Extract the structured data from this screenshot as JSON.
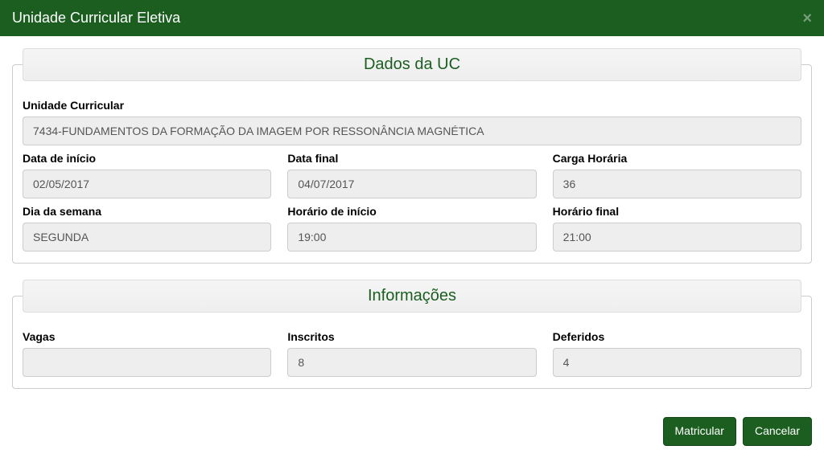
{
  "modal": {
    "title": "Unidade Curricular Eletiva"
  },
  "fieldsets": {
    "dadosUC": {
      "legend": "Dados da UC",
      "unidade_curricular": {
        "label": "Unidade Curricular",
        "value": "7434-FUNDAMENTOS DA FORMAÇÃO DA IMAGEM POR RESSONÂNCIA MAGNÉTICA"
      },
      "data_inicio": {
        "label": "Data de início",
        "value": "02/05/2017"
      },
      "data_final": {
        "label": "Data final",
        "value": "04/07/2017"
      },
      "carga_horaria": {
        "label": "Carga Horária",
        "value": "36"
      },
      "dia_semana": {
        "label": "Dia da semana",
        "value": "SEGUNDA"
      },
      "horario_inicio": {
        "label": "Horário de início",
        "value": "19:00"
      },
      "horario_final": {
        "label": "Horário final",
        "value": "21:00"
      }
    },
    "informacoes": {
      "legend": "Informações",
      "vagas": {
        "label": "Vagas",
        "value": ""
      },
      "inscritos": {
        "label": "Inscritos",
        "value": "8"
      },
      "deferidos": {
        "label": "Deferidos",
        "value": "4"
      }
    }
  },
  "footer": {
    "matricular": "Matricular",
    "cancelar": "Cancelar"
  }
}
